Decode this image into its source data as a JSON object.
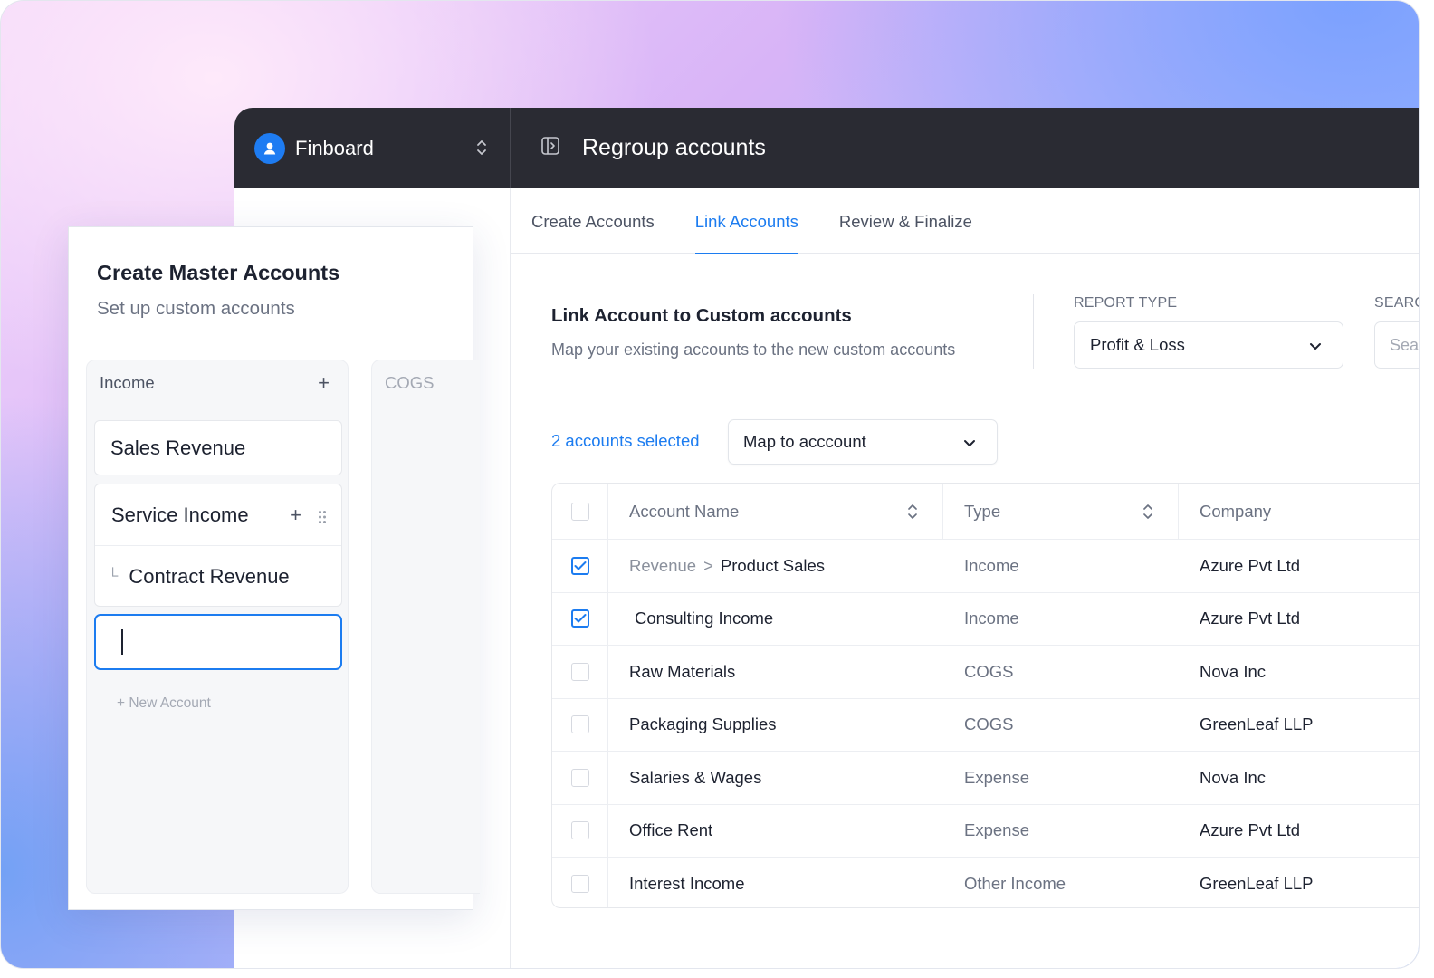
{
  "app": {
    "brand": "Finboard",
    "page_title": "Regroup accounts"
  },
  "tabs": [
    {
      "label": "Create Accounts",
      "active": false
    },
    {
      "label": "Link Accounts",
      "active": true
    },
    {
      "label": "Review & Finalize",
      "active": false
    }
  ],
  "link_section": {
    "title": "Link Account to Custom accounts",
    "subtitle": "Map your existing accounts to the new custom accounts",
    "report_type_label": "REPORT TYPE",
    "report_type_value": "Profit & Loss",
    "search_label": "SEARC",
    "search_placeholder": "Sea",
    "selected_count": "2 accounts selected",
    "map_select_value": "Map to acccount"
  },
  "table": {
    "columns": [
      "Account Name",
      "Type",
      "Company"
    ],
    "rows": [
      {
        "prefix": "Revenue",
        "sep": ">",
        "name": "Product Sales",
        "type": "Income",
        "company": "Azure Pvt Ltd",
        "checked": true
      },
      {
        "prefix": "",
        "sep": "",
        "name": "Consulting Income",
        "type": "Income",
        "company": "Azure Pvt Ltd",
        "checked": true
      },
      {
        "prefix": "",
        "sep": "",
        "name": "Raw Materials",
        "type": "COGS",
        "company": "Nova Inc",
        "checked": false
      },
      {
        "prefix": "",
        "sep": "",
        "name": "Packaging Supplies",
        "type": "COGS",
        "company": "GreenLeaf LLP",
        "checked": false
      },
      {
        "prefix": "",
        "sep": "",
        "name": "Salaries & Wages",
        "type": "Expense",
        "company": "Nova Inc",
        "checked": false
      },
      {
        "prefix": "",
        "sep": "",
        "name": "Office Rent",
        "type": "Expense",
        "company": "Azure Pvt Ltd",
        "checked": false
      },
      {
        "prefix": "",
        "sep": "",
        "name": "Interest Income",
        "type": "Other Income",
        "company": "GreenLeaf LLP",
        "checked": false
      }
    ]
  },
  "master_panel": {
    "title": "Create Master Accounts",
    "subtitle": "Set up custom accounts",
    "columns": [
      {
        "name": "Income",
        "accounts": [
          "Sales Revenue",
          "Service Income"
        ],
        "sub_accounts": [
          "Contract Revenue"
        ],
        "new_account_label": "+ New Account"
      },
      {
        "name": "COGS"
      }
    ]
  },
  "colors": {
    "accent": "#1c7cf0",
    "topbar": "#2a2b33"
  }
}
